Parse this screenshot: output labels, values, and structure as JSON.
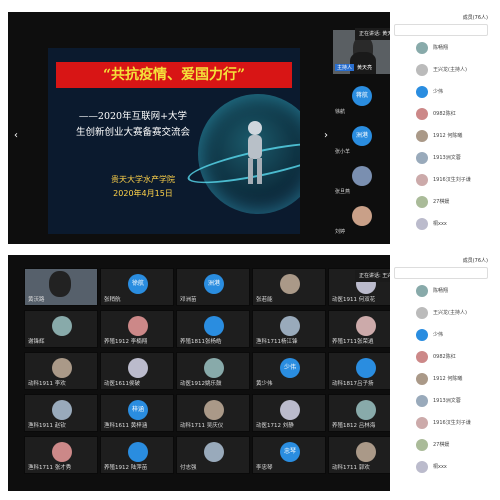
{
  "meeting_top": {
    "slide": {
      "title": "“共抗疫情、爱国力行”",
      "subtitle_line1": "——2020年互联网+大学",
      "subtitle_line2": "生创新创业大赛备赛交流会",
      "org": "贵天大学水产学院",
      "date": "2020年4月15日"
    },
    "popup_text": "正在讲话: 黄天亮; 陈少伟",
    "strip": [
      {
        "label": "蒋航",
        "name": "徐航"
      },
      {
        "label": "洲港",
        "name": "张小羊"
      },
      {
        "label": "",
        "name": "张旦燕"
      },
      {
        "label": "",
        "name": "刘婷"
      }
    ],
    "host_badge": "主持人",
    "host_name": "黄天亮"
  },
  "sidebar_top": {
    "header": "成员(76人)",
    "items": [
      {
        "label": "陈畅翔"
      },
      {
        "label": "王兴龙(主持人)"
      },
      {
        "label": "少伟"
      },
      {
        "label": "0982陈红"
      },
      {
        "label": "1912 何陈曦"
      },
      {
        "label": "1913洲文蓉"
      },
      {
        "label": "1916汉生刘子谦"
      },
      {
        "label": "27棋媛"
      },
      {
        "label": "桐xxx"
      }
    ]
  },
  "meeting_bottom": {
    "popup_text": "正在讲话: 王兴龙",
    "cells": [
      {
        "label": "",
        "name": "黄沃路",
        "host": true
      },
      {
        "label": "徐航",
        "name": "张稍航"
      },
      {
        "label": "洲港",
        "name": "邓洲苗"
      },
      {
        "label": "",
        "name": "张若能"
      },
      {
        "label": "",
        "name": "动医1911 何双花"
      },
      {
        "label": "",
        "name": "谢锋辉"
      },
      {
        "label": "",
        "name": "养殖1912 李楠翔"
      },
      {
        "label": "",
        "name": "养殖1811张杨皓"
      },
      {
        "label": "",
        "name": "渔科1711杨江锋"
      },
      {
        "label": "",
        "name": "养殖1711张荣逍"
      },
      {
        "label": "",
        "name": "动科1911 李欢"
      },
      {
        "label": "",
        "name": "动医1611侯破"
      },
      {
        "label": "",
        "name": "动医1912姚乐鼓"
      },
      {
        "label": "少伟",
        "name": "黄少伟"
      },
      {
        "label": "",
        "name": "动科1817吕子扬"
      },
      {
        "label": "",
        "name": "渔科1911 赵钦"
      },
      {
        "label": "梓涵",
        "name": "渔科1611 黄梓涵"
      },
      {
        "label": "",
        "name": "动科1711 吴庆仪"
      },
      {
        "label": "",
        "name": "动医1712 刘静"
      },
      {
        "label": "",
        "name": "养殖1812 吕林海"
      },
      {
        "label": "",
        "name": "渔科1711 张才秀"
      },
      {
        "label": "",
        "name": "养殖1912 陆萍苗"
      },
      {
        "label": "",
        "name": "付志强"
      },
      {
        "label": "忠琴",
        "name": "李忠琴"
      },
      {
        "label": "",
        "name": "动科1711 郭欢"
      }
    ]
  },
  "sidebar_bottom": {
    "header": "成员(76人)",
    "items": [
      {
        "label": "陈畅翔"
      },
      {
        "label": "王兴龙(主持人)"
      },
      {
        "label": "少伟"
      },
      {
        "label": "0982陈红"
      },
      {
        "label": "1912 何陈曦"
      },
      {
        "label": "1913洲文蓉"
      },
      {
        "label": "1916汉生刘子谦"
      },
      {
        "label": "27棋媛"
      },
      {
        "label": "桐xxx"
      }
    ]
  },
  "colors": {
    "accent": "#2a8de0",
    "slide_red": "#d81515",
    "title_yellow": "#f4e23a"
  }
}
